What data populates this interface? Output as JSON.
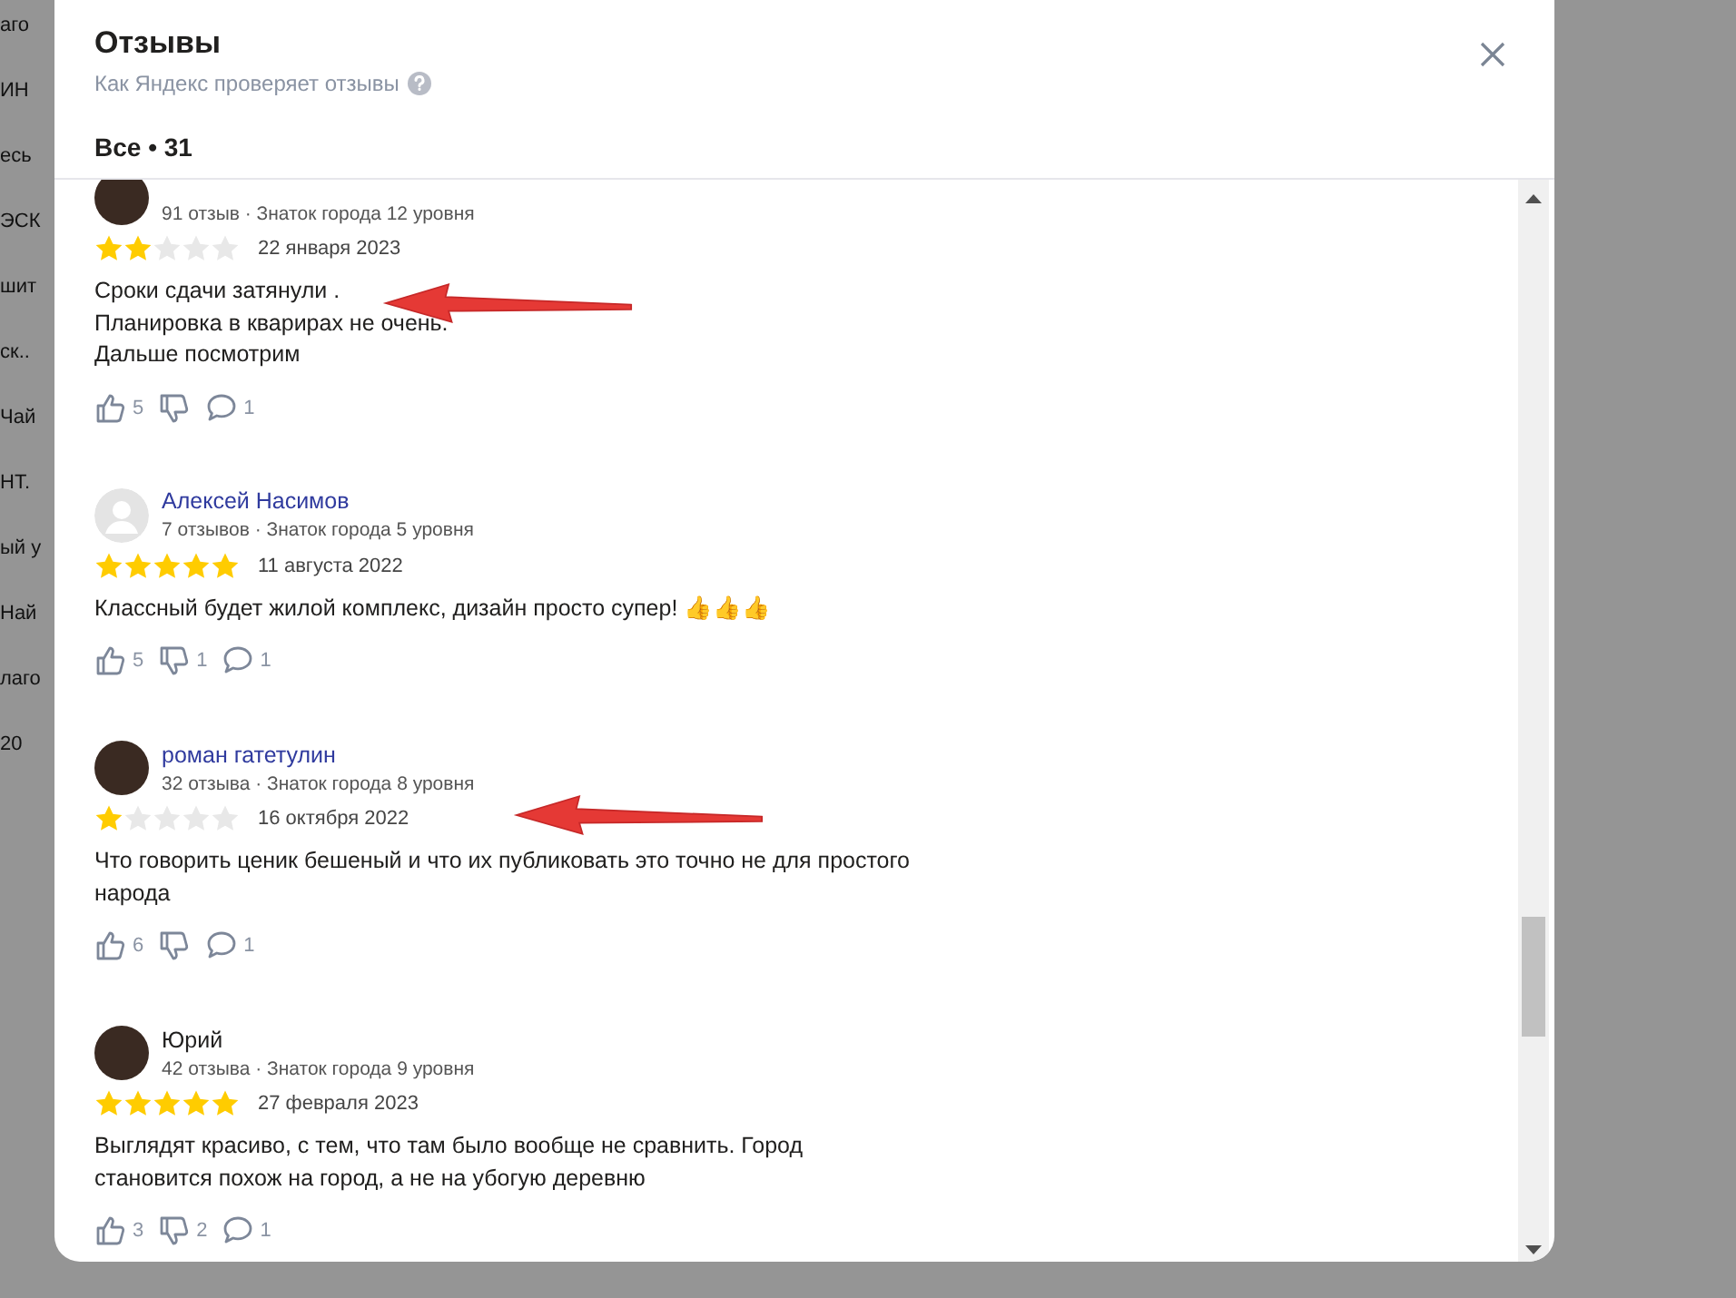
{
  "background_fragments": [
    "аго",
    "ИН",
    "есь",
    "ЭСК",
    "шит",
    "ск..",
    "Чай",
    "НТ.",
    "ый у",
    "Най",
    "лаго",
    "20"
  ],
  "dialog": {
    "title": "Отзывы",
    "subtitle": "Как Яндекс проверяет отзывы",
    "tabs": [
      {
        "label": "Все • 31",
        "selected": true
      }
    ]
  },
  "reviews": [
    {
      "avatar": {
        "kind": "photo"
      },
      "meta": "91 отзыв · Знаток города 12 уровня",
      "stars": 2,
      "date": "22 января 2023",
      "text": [
        "Сроки сдачи затянули .",
        "Планировка в кварирах не очень.",
        "Дальше посмотрим"
      ],
      "likes": "5",
      "comments": "1",
      "arrow": true
    },
    {
      "name": "Алексей Насимов",
      "linked": true,
      "avatar": {
        "kind": "default"
      },
      "meta": "7 отзывов · Знаток города 5 уровня",
      "stars": 5,
      "date": "11 августа 2022",
      "text": [
        "Классный будет жилой комплекс, дизайн просто супер! 👍👍👍"
      ],
      "likes": "5",
      "dislikes": "1",
      "comments": "1",
      "arrow": false
    },
    {
      "name": "роман гатетулин",
      "linked": true,
      "avatar": {
        "kind": "photo"
      },
      "meta": "32 отзыва · Знаток города 8 уровня",
      "stars": 1,
      "date": "16 октября 2022",
      "text": [
        "Что говорить ценик бешеный и что их публиковать это точно не для простого",
        "народа"
      ],
      "likes": "6",
      "comments": "1",
      "arrow": true
    },
    {
      "name": "Юрий",
      "linked": false,
      "avatar": {
        "kind": "photo"
      },
      "meta": "42 отзыва · Знаток города 9 уровня",
      "stars": 5,
      "date": "27 февраля 2023",
      "text": [
        "Выглядят красиво, с тем, что там было вообще не сравнить. Город",
        "становится похож на город, а не на убогую деревню"
      ],
      "likes": "3",
      "dislikes": "2",
      "comments": "1",
      "arrow": false
    }
  ]
}
